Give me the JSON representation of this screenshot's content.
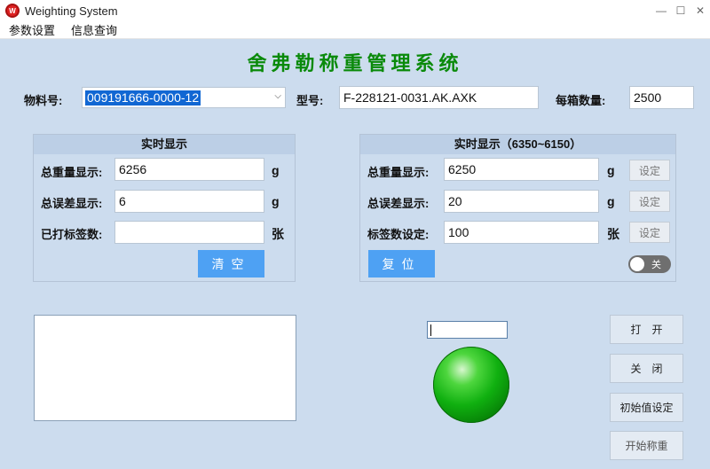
{
  "window": {
    "title": "Weighting System",
    "minimize": "—",
    "maximize": "☐",
    "close": "✕"
  },
  "menu": [
    {
      "label": "参数设置"
    },
    {
      "label": "信息查询"
    }
  ],
  "page_title": "舍弗勒称重管理系统",
  "material": {
    "label": "物料号:",
    "value": "009191666-0000-12"
  },
  "model": {
    "label": "型号:",
    "value": "F-228121-0031.AK.AXK"
  },
  "box_qty": {
    "label": "每箱数量:",
    "value": "2500"
  },
  "left_panel": {
    "header": "实时显示",
    "total_weight": {
      "label": "总重量显示:",
      "value": "6256",
      "unit": "g"
    },
    "total_error": {
      "label": "总误差显示:",
      "value": "6",
      "unit": "g"
    },
    "printed_labels": {
      "label": "已打标签数:",
      "value": "",
      "unit": "张"
    },
    "clear_button": "清空"
  },
  "right_panel": {
    "header": "实时显示（6350~6150）",
    "total_weight": {
      "label": "总重量显示:",
      "value": "6250",
      "unit": "g",
      "button": "设定"
    },
    "total_error": {
      "label": "总误差显示:",
      "value": "20",
      "unit": "g",
      "button": "设定"
    },
    "label_count": {
      "label": "标签数设定:",
      "value": "100",
      "unit": "张",
      "button": "设定"
    },
    "reset_button": "复位",
    "toggle": {
      "label": "关",
      "state": "off"
    }
  },
  "status_lamp": {
    "color": "#10b010",
    "state": "on"
  },
  "side_buttons": {
    "open": "打开",
    "close": "关闭",
    "init": "初始值设定",
    "start": "开始称重"
  },
  "colors": {
    "title_green": "#0a8a0a",
    "primary_button": "#4ea1f3",
    "background": "#ccdcee"
  }
}
